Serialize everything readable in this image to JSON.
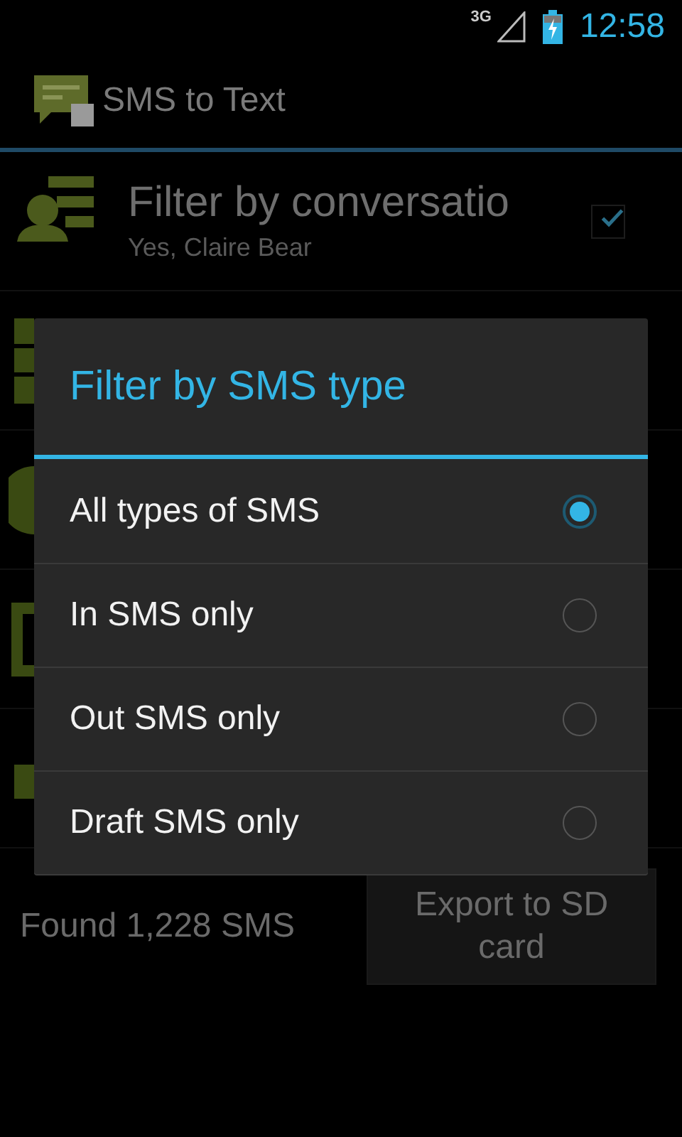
{
  "status_bar": {
    "network": "3G",
    "time": "12:58"
  },
  "action_bar": {
    "title": "SMS to Text"
  },
  "preference": {
    "title": "Filter by conversatio",
    "summary": "Yes, Claire Bear",
    "checked": true
  },
  "dialog": {
    "title": "Filter by SMS type",
    "options": [
      {
        "label": "All types of SMS",
        "selected": true
      },
      {
        "label": "In SMS only",
        "selected": false
      },
      {
        "label": "Out SMS only",
        "selected": false
      },
      {
        "label": "Draft SMS only",
        "selected": false
      }
    ]
  },
  "footer": {
    "count": "Found 1,228 SMS",
    "export_button": "Export to SD card"
  }
}
